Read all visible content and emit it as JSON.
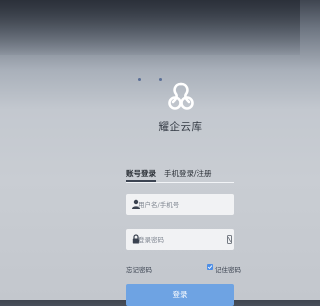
{
  "app": {
    "name": "耀企云库"
  },
  "tabs": [
    {
      "label": "账号登录",
      "active": true
    },
    {
      "label": "手机登录/注册",
      "active": false
    }
  ],
  "form": {
    "username_placeholder": "用户名/手机号",
    "password_placeholder": "登录密码",
    "forgot_label": "忘记密码",
    "remember_label": "记住密码",
    "remember_checked": true,
    "login_label": "登录"
  },
  "icons": {
    "logo": "logo-icon",
    "user": "user-icon",
    "lock": "lock-icon",
    "eye": "eye-toggle-icon",
    "check": "check-icon"
  },
  "colors": {
    "accent": "#6ea3e3",
    "checkbox": "#4d8ee6",
    "text": "#333a44"
  }
}
